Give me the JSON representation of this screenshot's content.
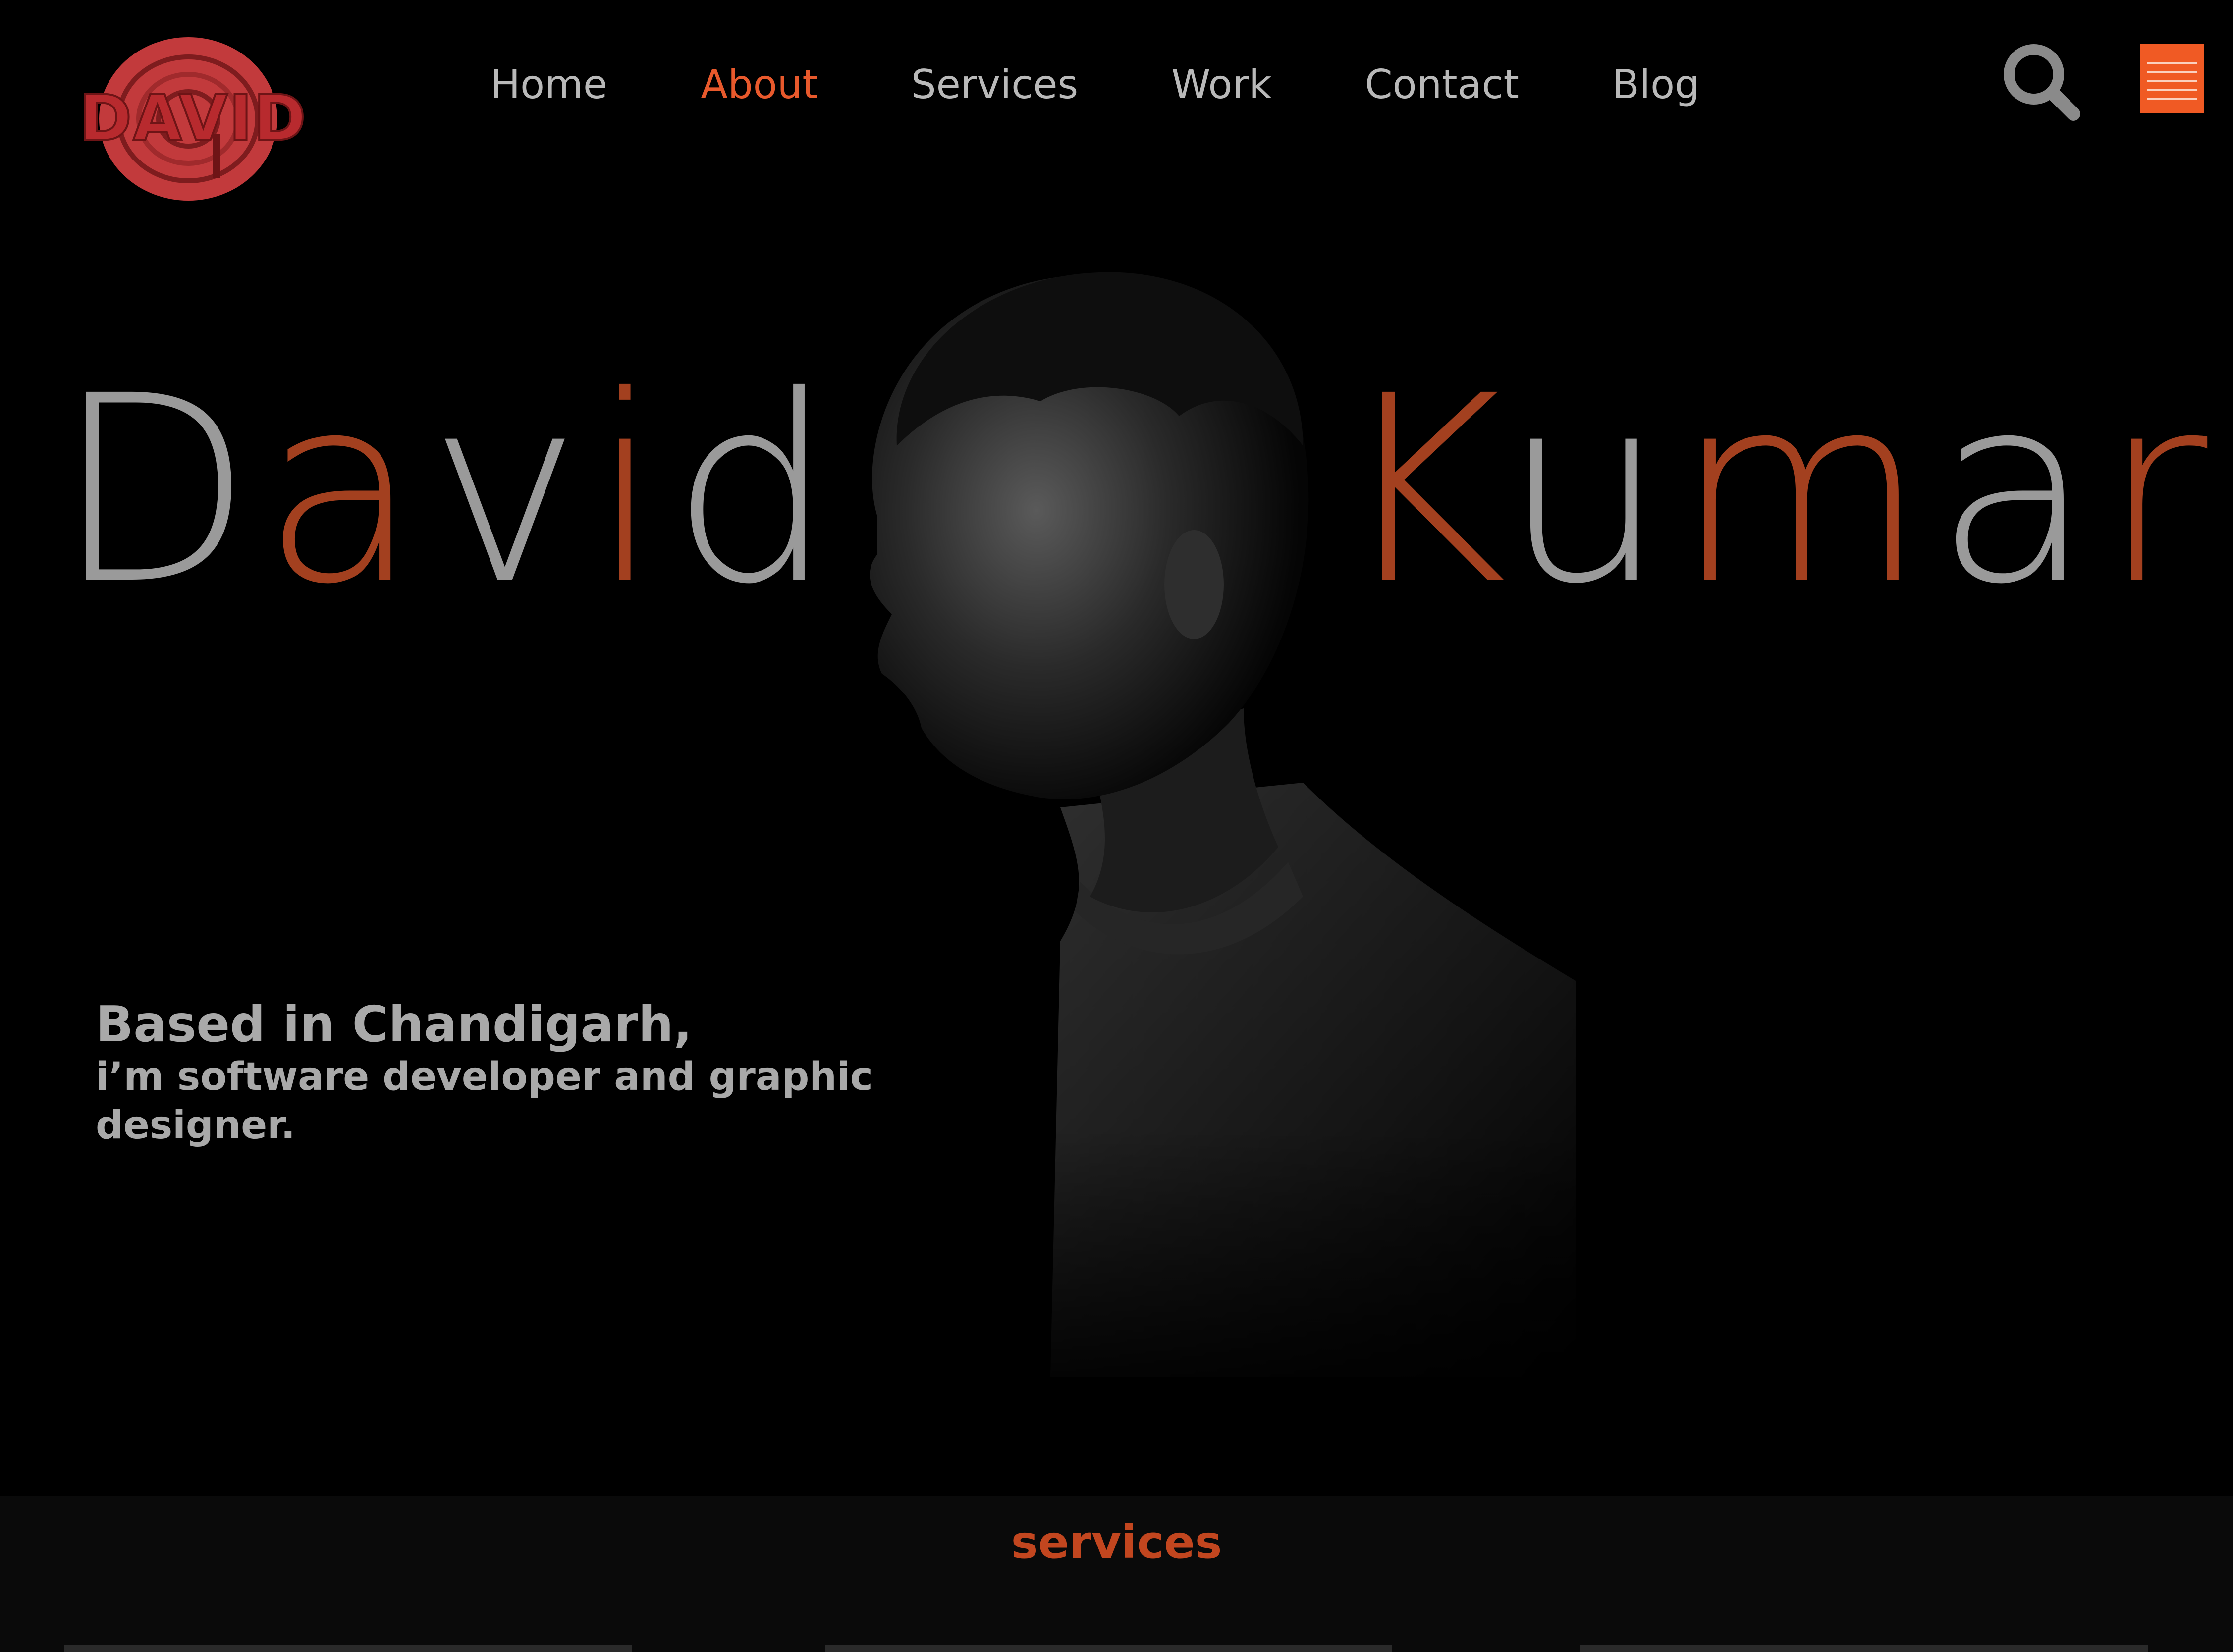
{
  "logo": {
    "text": "DAVID",
    "icon": "logo-emblem"
  },
  "nav": {
    "items": [
      {
        "label": "Home",
        "active": false
      },
      {
        "label": "About",
        "active": true
      },
      {
        "label": "Services",
        "active": false
      },
      {
        "label": "Work",
        "active": false
      },
      {
        "label": "Contact",
        "active": false
      },
      {
        "label": "Blog",
        "active": false
      }
    ]
  },
  "header": {
    "search_icon": "search-icon",
    "menu_icon": "hamburger-icon"
  },
  "hero": {
    "first_name": "David",
    "last_name": "Kumar",
    "tagline_line1": "Based in Chandigarh,",
    "tagline_line2": "i’m software developer and graphic designer."
  },
  "services": {
    "title": "services"
  },
  "colors": {
    "background": "#000000",
    "accent": "#e8592c",
    "name_orange": "#a3401f",
    "name_gray": "#9a9a9a",
    "text_gray": "#a9a9a9",
    "menu_button": "#f05a24",
    "logo_red": "#b82a2e"
  }
}
